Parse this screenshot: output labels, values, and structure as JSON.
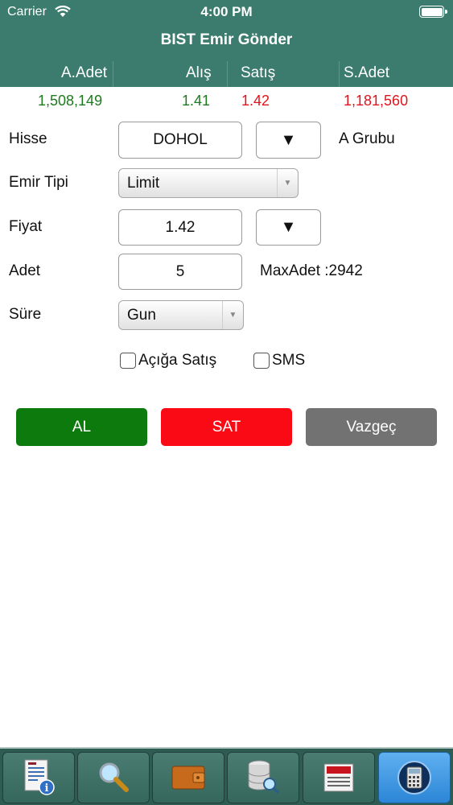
{
  "status": {
    "carrier": "Carrier",
    "time": "4:00 PM"
  },
  "header": {
    "title": "BIST Emir Gönder",
    "columns": [
      "A.Adet",
      "Alış",
      "Satış",
      "S.Adet"
    ]
  },
  "quote": {
    "bid_qty": "1,508,149",
    "bid": "1.41",
    "ask": "1.42",
    "ask_qty": "1,181,560"
  },
  "form": {
    "hisse_label": "Hisse",
    "hisse_value": "DOHOL",
    "hisse_dropdown_symbol": "▼",
    "group": "A Grubu",
    "emir_tipi_label": "Emir Tipi",
    "emir_tipi_value": "Limit",
    "fiyat_label": "Fiyat",
    "fiyat_value": "1.42",
    "fiyat_dropdown_symbol": "▼",
    "adet_label": "Adet",
    "adet_value": "5",
    "max_adet": "MaxAdet :2942",
    "sure_label": "Süre",
    "sure_value": "Gun",
    "aciga_satis_label": "Açığa Satış",
    "sms_label": "SMS"
  },
  "actions": {
    "buy": "AL",
    "sell": "SAT",
    "cancel": "Vazgeç"
  },
  "colors": {
    "header": "#3c7c6e",
    "buy": "#0d7a0d",
    "sell": "#fa0a14",
    "cancel": "#727272",
    "tab_active": "#2c86d6"
  },
  "tabbar": [
    "report-info-icon",
    "search-icon",
    "wallet-icon",
    "database-search-icon",
    "news-icon",
    "calculator-icon"
  ]
}
